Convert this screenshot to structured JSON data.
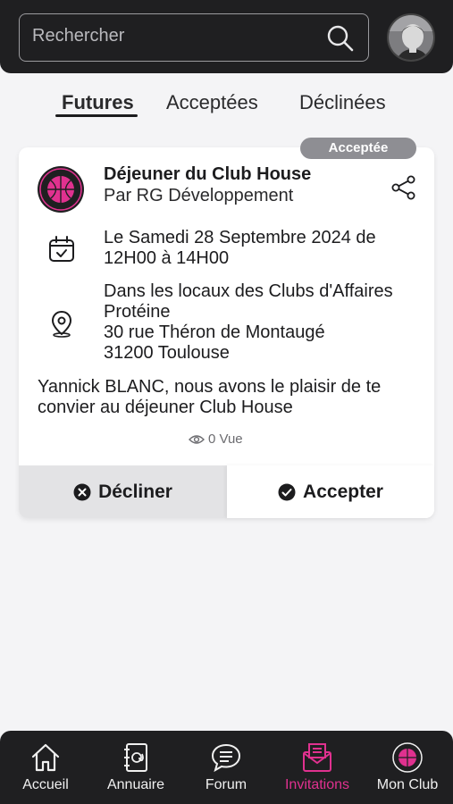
{
  "search": {
    "placeholder": "Rechercher"
  },
  "tabs": [
    {
      "label": "Futures",
      "active": true
    },
    {
      "label": "Acceptées",
      "active": false
    },
    {
      "label": "Déclinées",
      "active": false
    }
  ],
  "invitation": {
    "status_badge": "Acceptée",
    "title": "Déjeuner du Club House",
    "organizer": "Par RG Développement",
    "date_lines": [
      "Le Samedi 28 Septembre 2024 de",
      "12H00 à 14H00"
    ],
    "location_lines": [
      "Dans les locaux des Clubs d'Affaires",
      "Protéine",
      "30 rue Théron de Montaugé",
      "31200 Toulouse"
    ],
    "message_lines": [
      "Yannick BLANC, nous avons le plaisir de te",
      "convier au déjeuner Club House"
    ],
    "views": "0 Vue",
    "decline_label": "Décliner",
    "accept_label": "Accepter"
  },
  "bottom_nav": [
    {
      "label": "Accueil",
      "icon": "home-icon"
    },
    {
      "label": "Annuaire",
      "icon": "contacts-book-icon"
    },
    {
      "label": "Forum",
      "icon": "chat-bubble-icon"
    },
    {
      "label": "Invitations",
      "icon": "envelope-icon",
      "active": true
    },
    {
      "label": "Mon Club",
      "icon": "club-logo-icon"
    }
  ],
  "colors": {
    "accent": "#e0318f",
    "dark": "#1f1f21",
    "badge": "#8e8e93"
  }
}
